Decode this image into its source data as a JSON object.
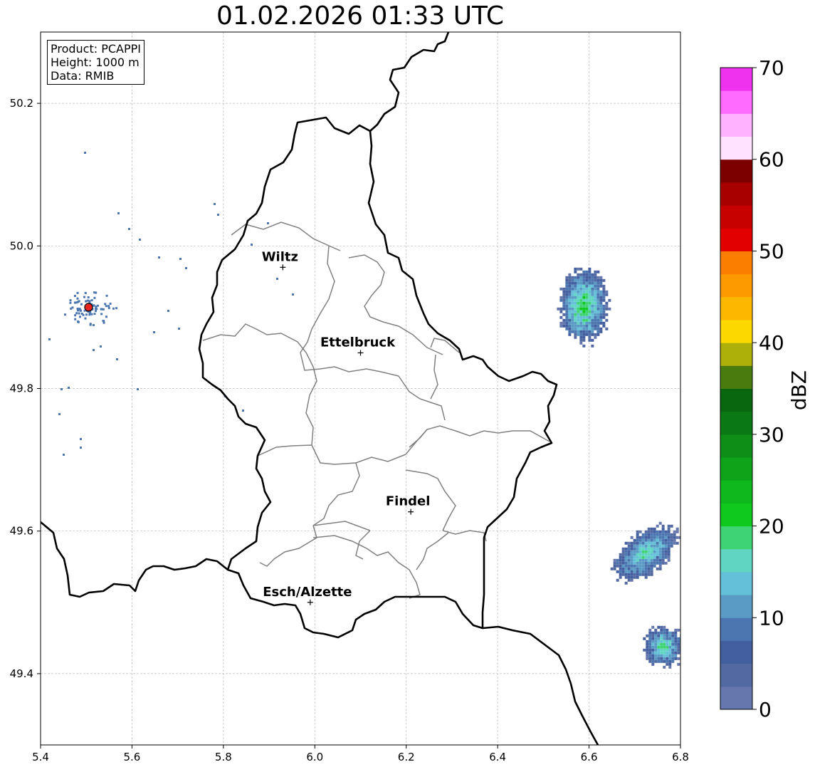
{
  "title": "01.02.2026 01:33 UTC",
  "info": {
    "product": "Product: PCAPPI",
    "height": "Height: 1000 m",
    "data": "Data: RMIB"
  },
  "axes": {
    "x_ticks": [
      "5.4",
      "5.6",
      "5.8",
      "6.0",
      "6.2",
      "6.4",
      "6.6",
      "6.8"
    ],
    "y_ticks": [
      "50.2",
      "50.0",
      "49.8",
      "49.6",
      "49.4"
    ],
    "xlim": [
      5.4,
      6.8
    ],
    "ylim": [
      49.3,
      50.3
    ],
    "grid": true
  },
  "cities": [
    {
      "name": "Wiltz",
      "lon": 5.93,
      "lat": 49.97
    },
    {
      "name": "Ettelbruck",
      "lon": 6.1,
      "lat": 49.85
    },
    {
      "name": "Findel",
      "lon": 6.21,
      "lat": 49.627
    },
    {
      "name": "Esch/Alzette",
      "lon": 5.99,
      "lat": 49.5
    }
  ],
  "radar_site": {
    "lon": 5.505,
    "lat": 49.914,
    "color": "#e8251f"
  },
  "colorbar": {
    "label": "dBZ",
    "ticks": [
      "0",
      "10",
      "20",
      "30",
      "40",
      "50",
      "60",
      "70"
    ],
    "min": 0,
    "max": 70,
    "step": 2.5,
    "colors": [
      "#6577ad",
      "#5369a1",
      "#435f9f",
      "#4b76b0",
      "#5a9bc6",
      "#64c0d8",
      "#60d6c2",
      "#3fd473",
      "#10c91f",
      "#0fb81c",
      "#0fa31a",
      "#0e8d17",
      "#0a7813",
      "#096710",
      "#4a7b0f",
      "#aeb00a",
      "#fdd700",
      "#fcb800",
      "#fc9a00",
      "#fc7e00",
      "#e30000",
      "#c70000",
      "#a80000",
      "#7c0000",
      "#ffe2ff",
      "#ffb2ff",
      "#ff6bff",
      "#ee32ee"
    ]
  },
  "echoes": [
    {
      "name": "echo-cluster-east",
      "lon": 6.585,
      "lat": 49.918,
      "rx": 0.055,
      "ry": 0.055,
      "peak_dbz": 22
    },
    {
      "name": "echo-band-southeast-1",
      "lon": 6.72,
      "lat": 49.57,
      "rx": 0.085,
      "ry": 0.03,
      "angle": -35,
      "peak_dbz": 18
    },
    {
      "name": "echo-band-southeast-2",
      "lon": 6.76,
      "lat": 49.44,
      "rx": 0.045,
      "ry": 0.03,
      "angle": -30,
      "peak_dbz": 19
    }
  ]
}
